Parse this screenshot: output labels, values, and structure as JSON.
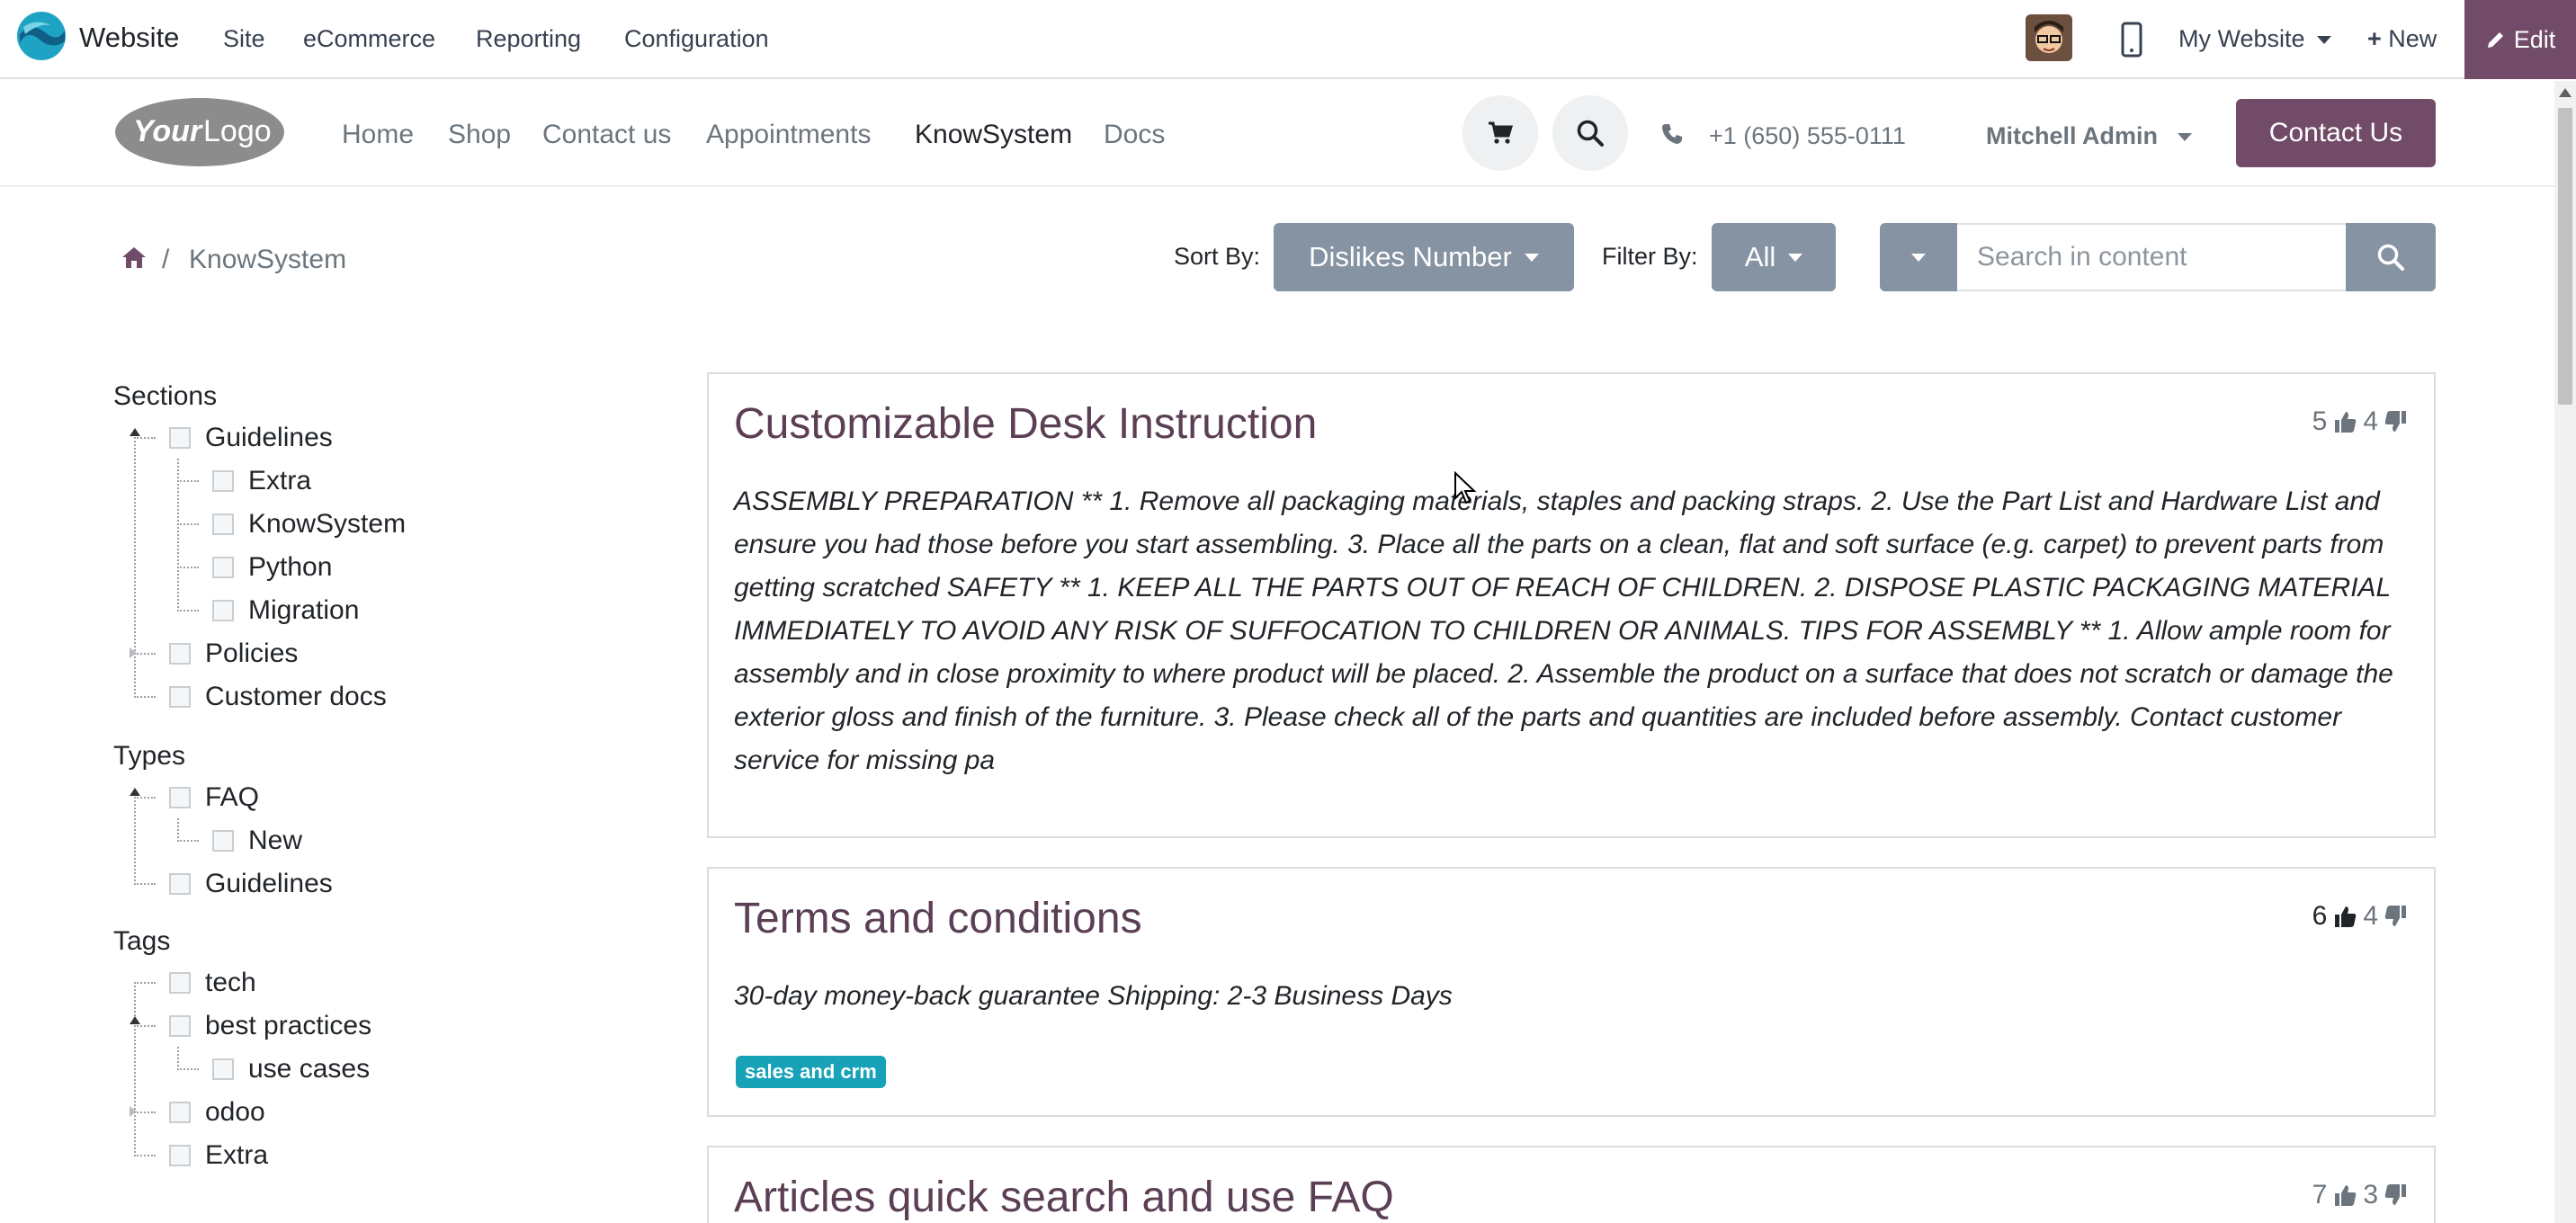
{
  "topbar": {
    "app_name": "Website",
    "menus": [
      "Site",
      "eCommerce",
      "Reporting",
      "Configuration"
    ],
    "my_website": "My Website",
    "new_label": "New",
    "edit_label": "Edit"
  },
  "site_header": {
    "logo_text": "YourLogo",
    "nav": [
      "Home",
      "Shop",
      "Contact us",
      "Appointments",
      "KnowSystem",
      "Docs"
    ],
    "phone": "+1 (650) 555-0111",
    "user": "Mitchell Admin",
    "contact_button": "Contact Us"
  },
  "breadcrumb": {
    "current": "KnowSystem"
  },
  "toolbar": {
    "sort_label": "Sort By:",
    "sort_value": "Dislikes Number",
    "filter_label": "Filter By:",
    "filter_value": "All",
    "search_placeholder": "Search in content"
  },
  "sidebar": {
    "sections_title": "Sections",
    "sections": [
      "Guidelines",
      "Extra",
      "KnowSystem",
      "Python",
      "Migration",
      "Policies",
      "Customer docs"
    ],
    "types_title": "Types",
    "types": [
      "FAQ",
      "New",
      "Guidelines"
    ],
    "tags_title": "Tags",
    "tags": [
      "tech",
      "best practices",
      "use cases",
      "odoo",
      "Extra"
    ]
  },
  "articles": [
    {
      "title": "Customizable Desk Instruction",
      "likes": "5",
      "dislikes": "4",
      "text": "ASSEMBLY PREPARATION ** 1. Remove all packaging materials, staples and packing straps. 2. Use the Part List and Hardware List and ensure you had those before you start assembling. 3. Place all the parts on a clean, flat and soft surface (e.g. carpet) to prevent parts from getting scratched SAFETY ** 1. KEEP ALL THE PARTS OUT OF REACH OF CHILDREN. 2. DISPOSE PLASTIC PACKAGING MATERIAL IMMEDIATELY TO AVOID ANY RISK OF SUFFOCATION TO CHILDREN OR ANIMALS. TIPS FOR ASSEMBLY ** 1. Allow ample room for assembly and in close proximity to where product will be placed. 2. Assemble the product on a surface that does not scratch or damage the exterior gloss and finish of the furniture. 3. Please check all of the parts and quantities are included before assembly. Contact customer service for missing pa"
    },
    {
      "title": "Terms and conditions",
      "likes": "6",
      "dislikes": "4",
      "text": "30-day money-back guarantee Shipping: 2-3 Business Days",
      "tag": "sales and crm"
    },
    {
      "title": "Articles quick search and use FAQ",
      "likes": "7",
      "dislikes": "3"
    }
  ],
  "colors": {
    "brand": "#714b67",
    "title": "#5b3f55",
    "grey_button": "#8593a3",
    "badge": "#17a2b8"
  }
}
